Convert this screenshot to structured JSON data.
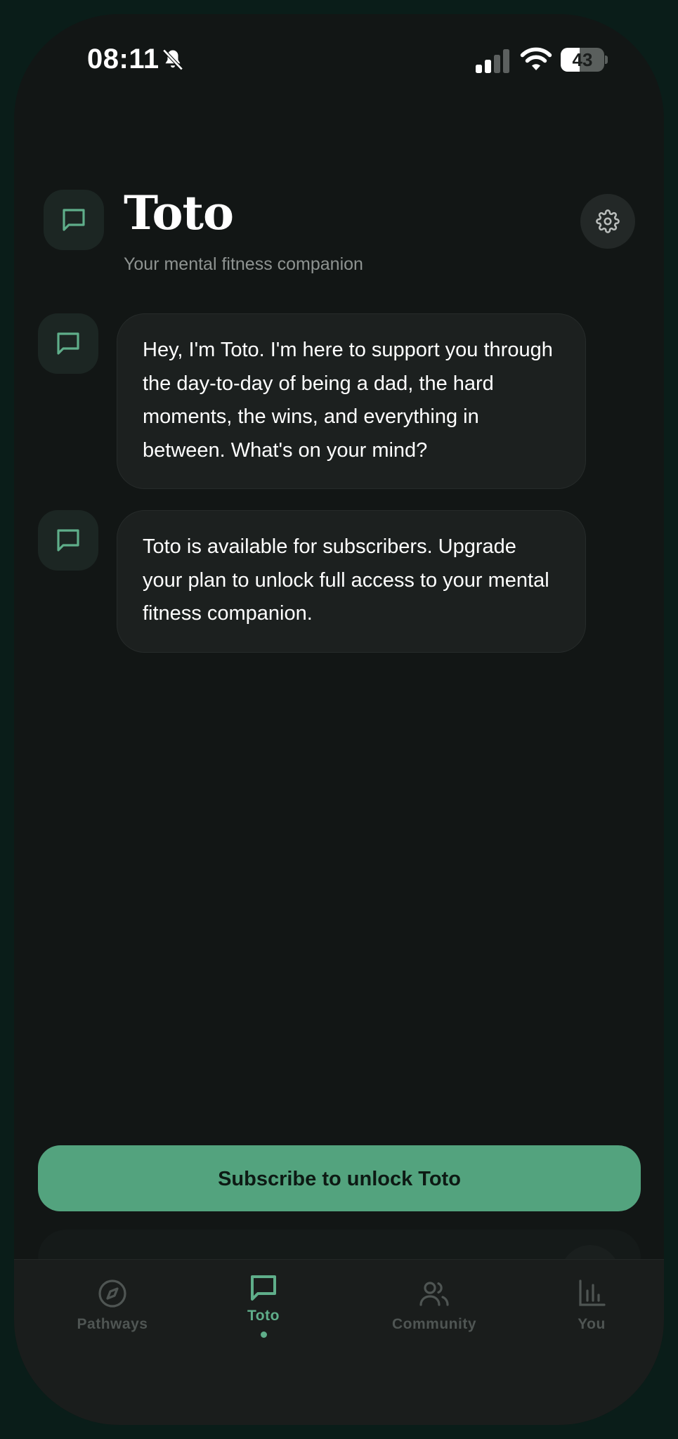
{
  "status_bar": {
    "time": "08:11",
    "battery_level": "43",
    "battery_fraction": 0.43,
    "icons": [
      "bell-off-icon",
      "signal-icon",
      "wifi-icon",
      "battery-icon"
    ]
  },
  "header": {
    "title": "Toto",
    "subtitle": "Your mental fitness companion",
    "avatar_icon": "message-square-icon",
    "settings_icon": "gear-icon"
  },
  "messages": [
    {
      "icon": "message-square-icon",
      "text": "Hey, I'm Toto. I'm here to support you through the day-to-day of being a dad, the hard moments, the wins, and everything in between. What's on your mind?"
    },
    {
      "icon": "message-square-icon",
      "text": "Toto is available for subscribers. Upgrade your plan to unlock full access to your mental fitness companion."
    }
  ],
  "cta": {
    "label": "Subscribe to unlock Toto"
  },
  "tab_bar": {
    "tabs": [
      {
        "label": "Pathways",
        "icon": "compass-icon",
        "active": false
      },
      {
        "label": "Toto",
        "icon": "message-square-icon",
        "active": true
      },
      {
        "label": "Community",
        "icon": "users-icon",
        "active": false
      },
      {
        "label": "You",
        "icon": "bar-chart-icon",
        "active": false
      }
    ]
  },
  "colors": {
    "accent": "#5fae8a",
    "button": "#53a37e",
    "background": "#121615",
    "bubble": "#1c201f",
    "muted_text": "#8e9391"
  }
}
